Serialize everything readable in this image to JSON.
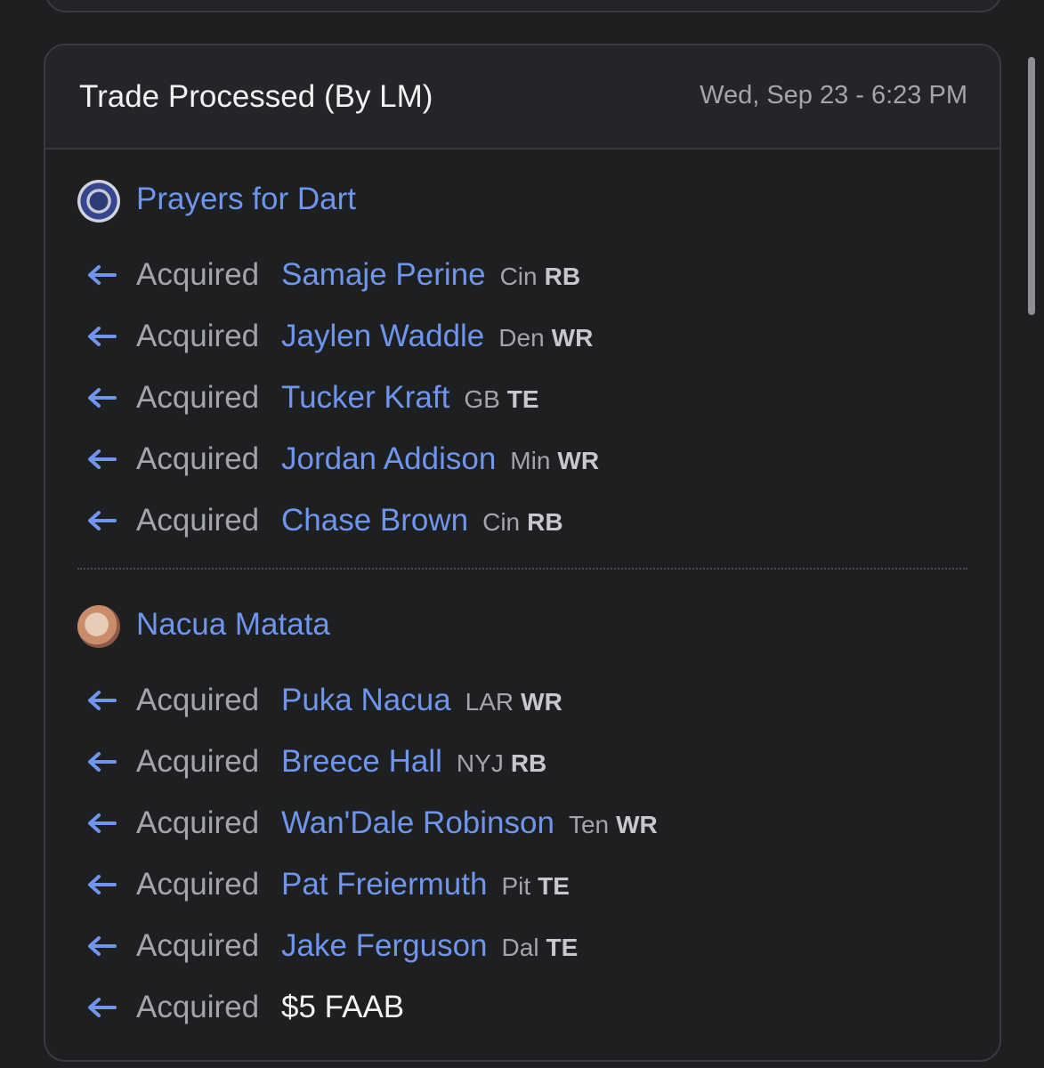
{
  "card": {
    "title": "Trade Processed (By LM)",
    "timestamp": "Wed, Sep 23 - 6:23 PM"
  },
  "teams": [
    {
      "name": "Prayers for Dart",
      "rows": [
        {
          "action": "Acquired",
          "player": "Samaje Perine",
          "team": "Cin",
          "pos": "RB"
        },
        {
          "action": "Acquired",
          "player": "Jaylen Waddle",
          "team": "Den",
          "pos": "WR"
        },
        {
          "action": "Acquired",
          "player": "Tucker Kraft",
          "team": "GB",
          "pos": "TE"
        },
        {
          "action": "Acquired",
          "player": "Jordan Addison",
          "team": "Min",
          "pos": "WR"
        },
        {
          "action": "Acquired",
          "player": "Chase Brown",
          "team": "Cin",
          "pos": "RB"
        }
      ]
    },
    {
      "name": "Nacua Matata",
      "rows": [
        {
          "action": "Acquired",
          "player": "Puka Nacua",
          "team": "LAR",
          "pos": "WR"
        },
        {
          "action": "Acquired",
          "player": "Breece Hall",
          "team": "NYJ",
          "pos": "RB"
        },
        {
          "action": "Acquired",
          "player": "Wan'Dale Robinson",
          "team": "Ten",
          "pos": "WR"
        },
        {
          "action": "Acquired",
          "player": "Pat Freiermuth",
          "team": "Pit",
          "pos": "TE"
        },
        {
          "action": "Acquired",
          "player": "Jake Ferguson",
          "team": "Dal",
          "pos": "TE"
        },
        {
          "action": "Acquired",
          "faab": "$5 FAAB"
        }
      ]
    }
  ],
  "icons": {
    "row_icon": "arrow-left-icon",
    "team_icon": "avatar"
  },
  "colors": {
    "background": "#1e1f21",
    "header_bg": "#242528",
    "link": "#6f95ec",
    "muted": "#a3a5a9",
    "text": "#f2f2f3"
  }
}
